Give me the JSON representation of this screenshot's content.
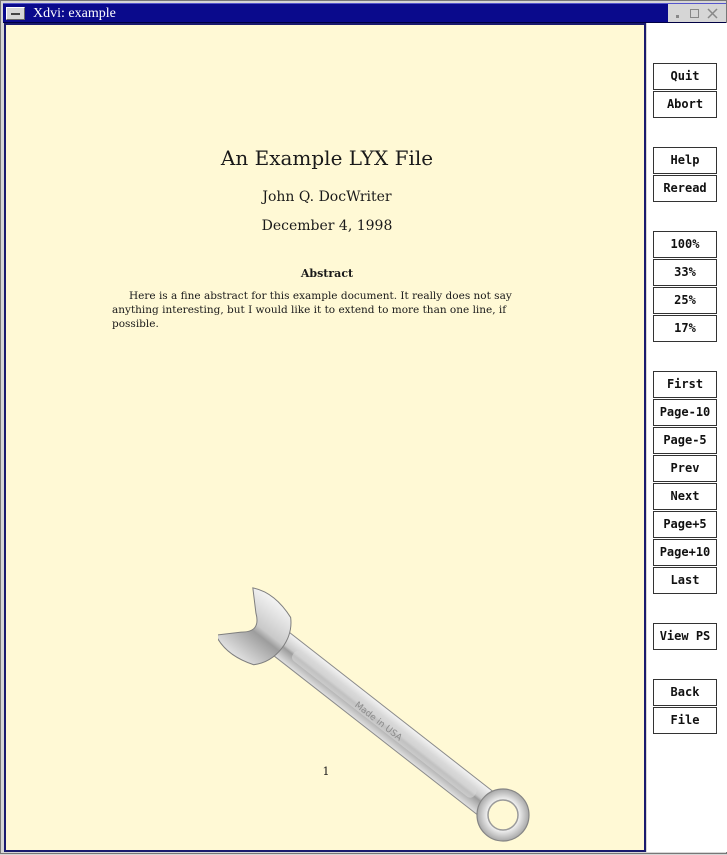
{
  "window": {
    "title": "Xdvi:  example"
  },
  "document": {
    "title": "An Example LYX File",
    "author": "John Q. DocWriter",
    "date": "December 4, 1998",
    "abstract_heading": "Abstract",
    "abstract_text": "Here is a fine abstract for this example document. It really does not say anything interesting, but I would like it to extend to more than one line, if possible.",
    "page_number": "1",
    "wrench_etching": "Made in USA"
  },
  "sidebar": {
    "quit": "Quit",
    "abort": "Abort",
    "help": "Help",
    "reread": "Reread",
    "zoom_100": "100%",
    "zoom_33": "33%",
    "zoom_25": "25%",
    "zoom_17": "17%",
    "first": "First",
    "page_minus_10": "Page-10",
    "page_minus_5": "Page-5",
    "prev": "Prev",
    "next": "Next",
    "page_plus_5": "Page+5",
    "page_plus_10": "Page+10",
    "last": "Last",
    "view_ps": "View PS",
    "back": "Back",
    "file": "File"
  },
  "colors": {
    "titlebar": "#0a0a8c",
    "page_background": "#fff9d5",
    "page_border": "#1a1a6e"
  },
  "icons": {
    "window_menu": "window-menu-icon",
    "minimize": "minimize-icon",
    "maximize": "maximize-icon",
    "close": "close-icon",
    "wrench": "wrench-icon"
  }
}
